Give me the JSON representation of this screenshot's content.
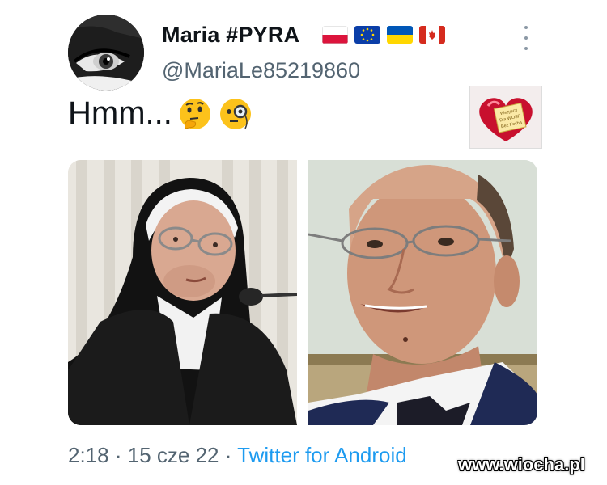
{
  "tweet": {
    "display_name": "Maria #PYRA",
    "handle": "@MariaLe85219860",
    "text": "Hmm...",
    "emojis": [
      "thinking-face-icon",
      "face-with-monocle-icon"
    ],
    "flags": [
      "flag-poland-icon",
      "flag-eu-icon",
      "flag-ukraine-icon",
      "flag-canada-icon"
    ],
    "time": "2:18",
    "date": "15 cze 22",
    "source": "Twitter for Android",
    "separator": "·",
    "sticker_text": [
      "Wszyscy",
      "Dla WOŚP",
      "Bez Focha"
    ]
  },
  "watermark": "www.wiocha.pl",
  "colors": {
    "text_primary": "#0f1419",
    "text_secondary": "#536471",
    "link": "#1d9bf0",
    "more_dots": "#8b98a5"
  }
}
